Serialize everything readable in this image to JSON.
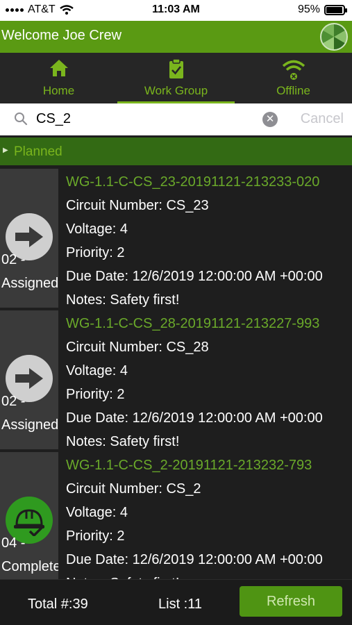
{
  "status_bar": {
    "carrier": "AT&T",
    "time": "11:03 AM",
    "battery_percent": "95%",
    "battery_level": 0.95
  },
  "header": {
    "welcome": "Welcome  Joe Crew",
    "logo_icon": "app-logo"
  },
  "nav": {
    "tabs": [
      {
        "label": "Home",
        "icon": "home-icon",
        "active": false
      },
      {
        "label": "Work Group",
        "icon": "clipboard-check-icon",
        "active": true
      },
      {
        "label": "Offline",
        "icon": "wifi-offline-icon",
        "active": false
      }
    ]
  },
  "search": {
    "value": "CS_2",
    "cancel_label": "Cancel"
  },
  "section": {
    "label": "Planned"
  },
  "items": [
    {
      "title": "WG-1.1-C-CS_23-20191121-213233-020",
      "status": "02 - Assigned",
      "icon": "arrow-right-icon",
      "fields": [
        "Circuit Number: CS_23",
        "Voltage: 4",
        "Priority: 2",
        "Due Date: 12/6/2019 12:00:00 AM +00:00",
        "Notes: Safety first!"
      ]
    },
    {
      "title": "WG-1.1-C-CS_28-20191121-213227-993",
      "status": "02 - Assigned",
      "icon": "arrow-right-icon",
      "fields": [
        "Circuit Number: CS_28",
        "Voltage: 4",
        "Priority: 2",
        "Due Date: 12/6/2019 12:00:00 AM +00:00",
        "Notes: Safety first!"
      ]
    },
    {
      "title": "WG-1.1-C-CS_2-20191121-213232-793",
      "status": "04 - Complete",
      "icon": "hardhat-check-icon",
      "fields": [
        "Circuit Number: CS_2",
        "Voltage: 4",
        "Priority: 2",
        "Due Date: 12/6/2019 12:00:00 AM +00:00",
        "Notes: Safety first!"
      ]
    }
  ],
  "footer": {
    "total": "Total #:39",
    "list": "List :11",
    "refresh_label": "Refresh"
  },
  "colors": {
    "brand_green": "#5a9a13",
    "accent_green": "#7ab51d",
    "section_green": "#336a14"
  }
}
